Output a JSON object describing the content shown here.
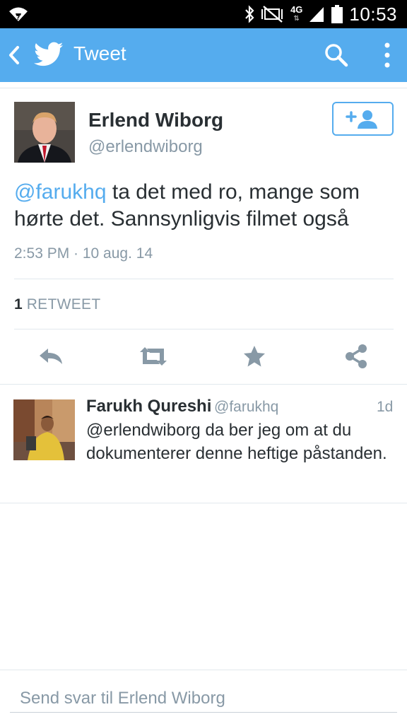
{
  "status_bar": {
    "network": "4G",
    "time": "10:53"
  },
  "action_bar": {
    "title": "Tweet"
  },
  "tweet": {
    "author_name": "Erlend Wiborg",
    "author_handle": "@erlendwiborg",
    "mention": "@farukhq",
    "text_rest": " ta det med ro, mange som hørte det. Sannsynligvis filmet også",
    "timestamp": "2:53 PM · 10 aug. 14",
    "retweet_count": "1",
    "retweet_label": "RETWEET"
  },
  "reply": {
    "author_name": "Farukh Qureshi",
    "author_handle": "@farukhq",
    "time_ago": "1d",
    "text": "@erlendwiborg da ber jeg om at du dokumenterer denne heftige påstanden."
  },
  "reply_box": {
    "placeholder": "Send svar til Erlend Wiborg"
  },
  "colors": {
    "accent": "#55acee",
    "meta_gray": "#8899a6",
    "action_gray": "#8899a6"
  }
}
